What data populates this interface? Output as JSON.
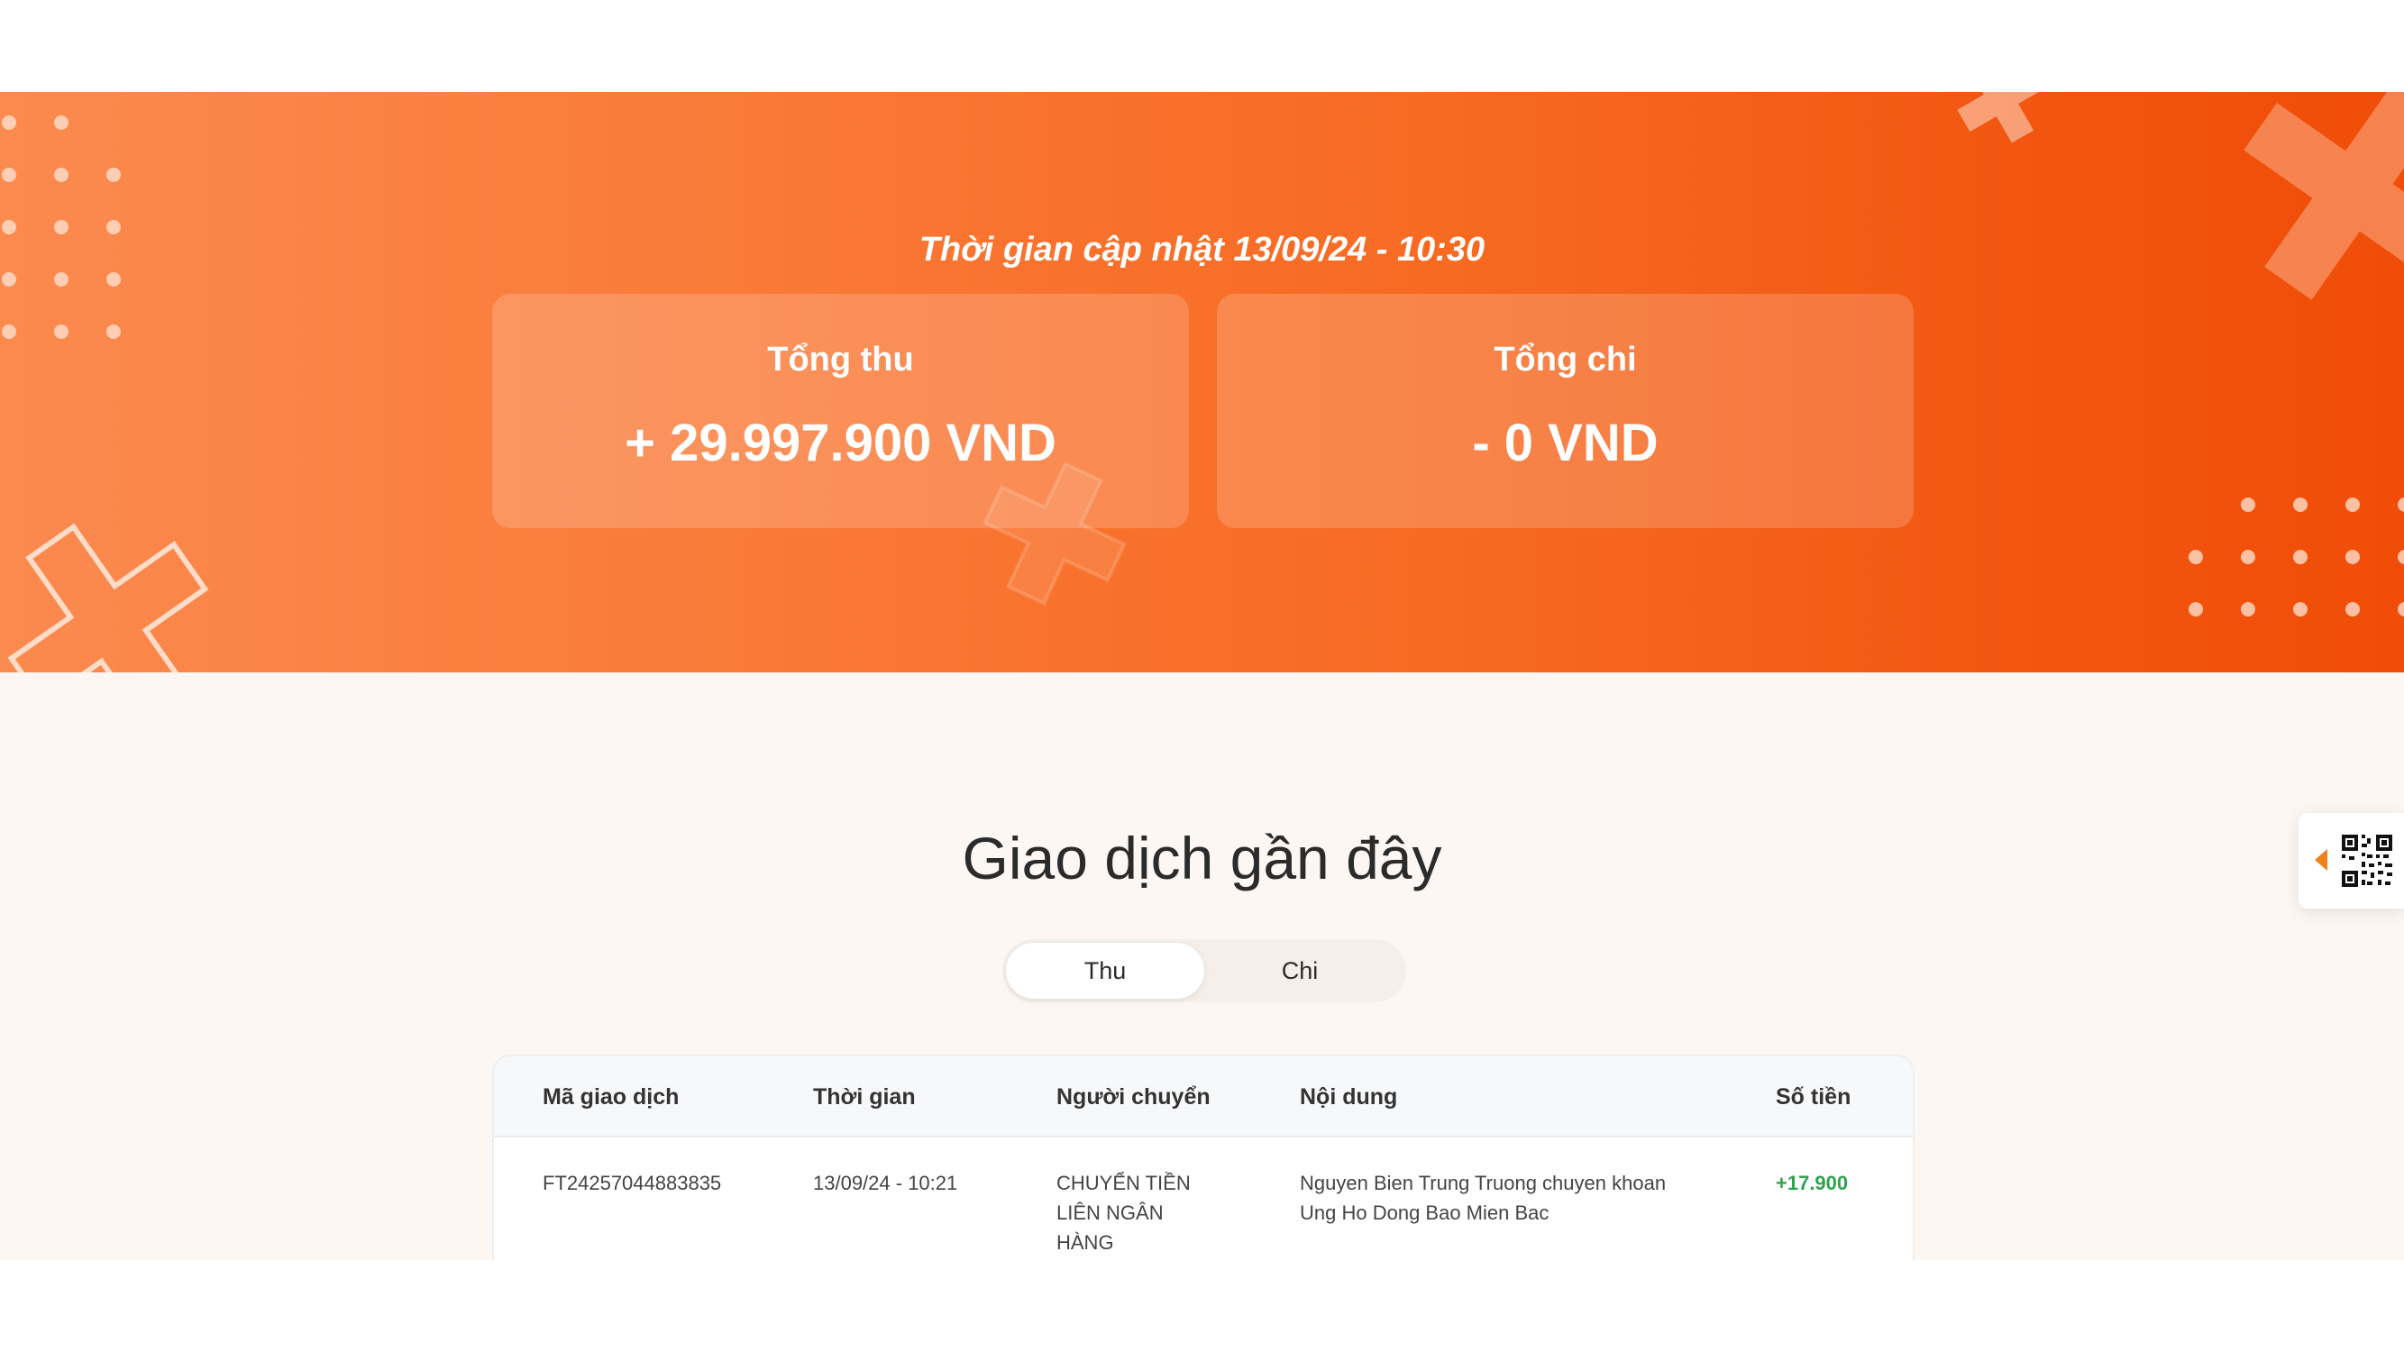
{
  "hero": {
    "update_time": "Thời gian cập nhật 13/09/24 - 10:30",
    "income": {
      "label": "Tổng thu",
      "value": "+ 29.997.900 VND"
    },
    "expense": {
      "label": "Tổng chi",
      "value": "- 0 VND"
    }
  },
  "transactions": {
    "title": "Giao dịch gần đây",
    "tabs": [
      {
        "label": "Thu",
        "active": true
      },
      {
        "label": "Chi",
        "active": false
      }
    ],
    "columns": [
      "Mã giao dịch",
      "Thời gian",
      "Người chuyển",
      "Nội dung",
      "Số tiền"
    ],
    "rows": [
      {
        "id": "FT24257044883835",
        "time": "13/09/24 - 10:21",
        "sender": "CHUYỂN TIỀN LIÊN NGÂN HÀNG",
        "content": "Nguyen Bien Trung Truong chuyen khoan Ung Ho Dong Bao Mien Bac",
        "amount": "+17.900"
      }
    ]
  },
  "widgets": {
    "qr_icon": "qr-code-icon",
    "arrow_icon": "caret-left-icon"
  },
  "colors": {
    "hero_start": "#fb8a4f",
    "hero_end": "#f04d08",
    "content_bg": "#fdf7f3",
    "positive_amount": "#2ea44f",
    "accent": "#f0801a"
  }
}
